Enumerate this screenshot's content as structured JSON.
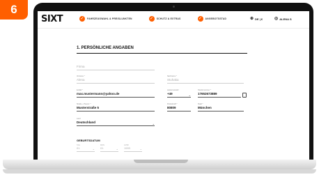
{
  "step_badge": "6",
  "app": {
    "logo": "SIXT",
    "steps": [
      {
        "label": "FAHRZEUGWAHL & PREISLUNKTEN"
      },
      {
        "label": "SCHUTZ & EXTRAS"
      },
      {
        "label": "ANGEBOTSSTAD"
      }
    ],
    "language": "DE | €",
    "user": "ALENA S"
  },
  "form": {
    "section_title": "1. PERSÖNLICHE ANGABEN",
    "company": {
      "placeholder": "Firma"
    },
    "first_name": {
      "label": "Vorname *",
      "value": "Alena"
    },
    "last_name": {
      "label": "Nachname *",
      "value": "Stuhaka"
    },
    "email": {
      "label": "E-Mail *",
      "value": "max.mustermann@yahoo.de"
    },
    "country_code": {
      "label": "Ländervorwahl",
      "value": "+49"
    },
    "phone": {
      "label": "Telefonnummer *",
      "value": "17652673889"
    },
    "street": {
      "label": "Straße + Hausnr. *",
      "value": "Musterstraße 5"
    },
    "zip": {
      "label": "Postleitzahl *",
      "value": "80809"
    },
    "city": {
      "label": "Stadt *",
      "value": "München"
    },
    "country": {
      "label": "Land",
      "value": "Deutschland"
    },
    "dob": {
      "title": "GEBURTSDATUM",
      "day": {
        "label": "TAG",
        "value": "01"
      },
      "month": {
        "label": "MON",
        "value": "01"
      },
      "year": {
        "label": "JAHR",
        "value": "1993"
      }
    }
  },
  "colors": {
    "accent": "#ff5f00",
    "frame": "#111111"
  }
}
